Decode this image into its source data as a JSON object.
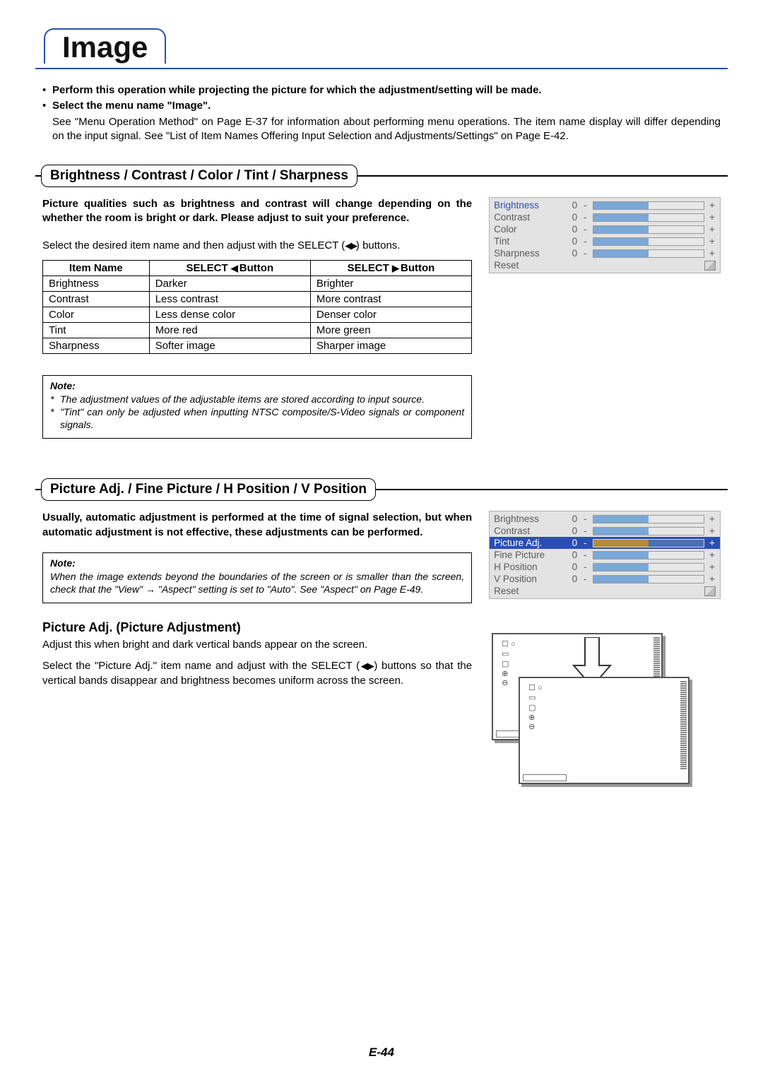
{
  "title": "Image",
  "intro": {
    "b1": "Perform this operation while projecting the picture for which the adjustment/setting will be made.",
    "b2": "Select the menu name \"Image\".",
    "detail": "See \"Menu Operation Method\" on Page E-37 for information about performing menu operations. The item name display will differ depending on the input signal. See \"List of Item Names Offering Input Selection and Adjustments/Settings\" on Page E-42."
  },
  "section1": {
    "heading": "Brightness / Contrast / Color / Tint / Sharpness",
    "lead": "Picture qualities such as brightness and contrast will change depending on the whether the room is bright or dark. Please adjust to suit your preference.",
    "instr_a": "Select the desired item name and then adjust with the SELECT (",
    "instr_b": ") buttons.",
    "table": {
      "h1": "Item Name",
      "h2_a": "SELECT ",
      "h2_b": " Button",
      "h3_a": "SELECT ",
      "h3_b": " Button",
      "rows": [
        [
          "Brightness",
          "Darker",
          "Brighter"
        ],
        [
          "Contrast",
          "Less contrast",
          "More contrast"
        ],
        [
          "Color",
          "Less dense color",
          "Denser color"
        ],
        [
          "Tint",
          "More red",
          "More green"
        ],
        [
          "Sharpness",
          "Softer image",
          "Sharper image"
        ]
      ]
    },
    "note": {
      "title": "Note:",
      "l1": "The adjustment values of the adjustable items are stored according to input source.",
      "l2": "\"Tint\" can only be adjusted when inputting NTSC composite/S-Video signals or component signals."
    },
    "osd": {
      "items": [
        {
          "name": "Brightness",
          "val": "0",
          "highlight": true
        },
        {
          "name": "Contrast",
          "val": "0"
        },
        {
          "name": "Color",
          "val": "0"
        },
        {
          "name": "Tint",
          "val": "0"
        },
        {
          "name": "Sharpness",
          "val": "0"
        }
      ],
      "reset": "Reset"
    }
  },
  "section2": {
    "heading": "Picture Adj. / Fine Picture / H Position / V Position",
    "lead": "Usually, automatic adjustment is performed at the time of signal selection, but when automatic adjustment is not effective, these adjustments can be performed.",
    "note": {
      "title": "Note:",
      "text": "When the image extends beyond the boundaries of the screen or is smaller than the screen, check that the \"View\" → \"Aspect\" setting is set to \"Auto\". See \"Aspect\" on Page E-49."
    },
    "osd": {
      "items": [
        {
          "name": "Brightness",
          "val": "0"
        },
        {
          "name": "Contrast",
          "val": "0"
        },
        {
          "name": "Picture Adj.",
          "val": "0",
          "selected": true
        },
        {
          "name": "Fine Picture",
          "val": "0"
        },
        {
          "name": "H Position",
          "val": "0"
        },
        {
          "name": "V Position",
          "val": "0"
        }
      ],
      "reset": "Reset"
    },
    "sub": {
      "h": "Picture Adj. (Picture Adjustment)",
      "p1": "Adjust this when bright and dark vertical bands appear on the screen.",
      "p2a": "Select the \"Picture Adj.\" item name and adjust with the SELECT (",
      "p2b": ") buttons so that the vertical bands disappear and brightness becomes uniform across the screen."
    }
  },
  "footer": "E-44",
  "glyphs": "◀ ▶"
}
